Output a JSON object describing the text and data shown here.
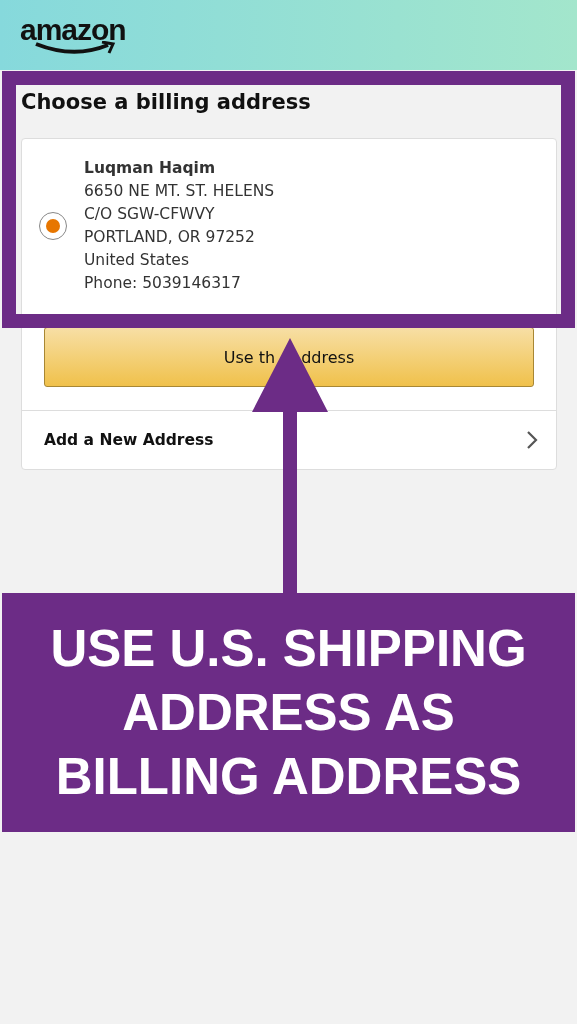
{
  "header": {
    "logo": "amazon"
  },
  "title": "Choose a billing address",
  "addresses": [
    {
      "name": "Luqman Haqim",
      "lines": [
        "6650 NE MT. ST. HELENS",
        "C/O SGW-CFWVY",
        "PORTLAND, OR 97252",
        "United States",
        "Phone: 5039146317"
      ],
      "selected": true
    }
  ],
  "use_button": [
    "Use th",
    "ddress"
  ],
  "add_address": "Add a New Address",
  "annotation": {
    "caption": "USE U.S. SHIPPING ADDRESS AS BILLING ADDRESS"
  }
}
